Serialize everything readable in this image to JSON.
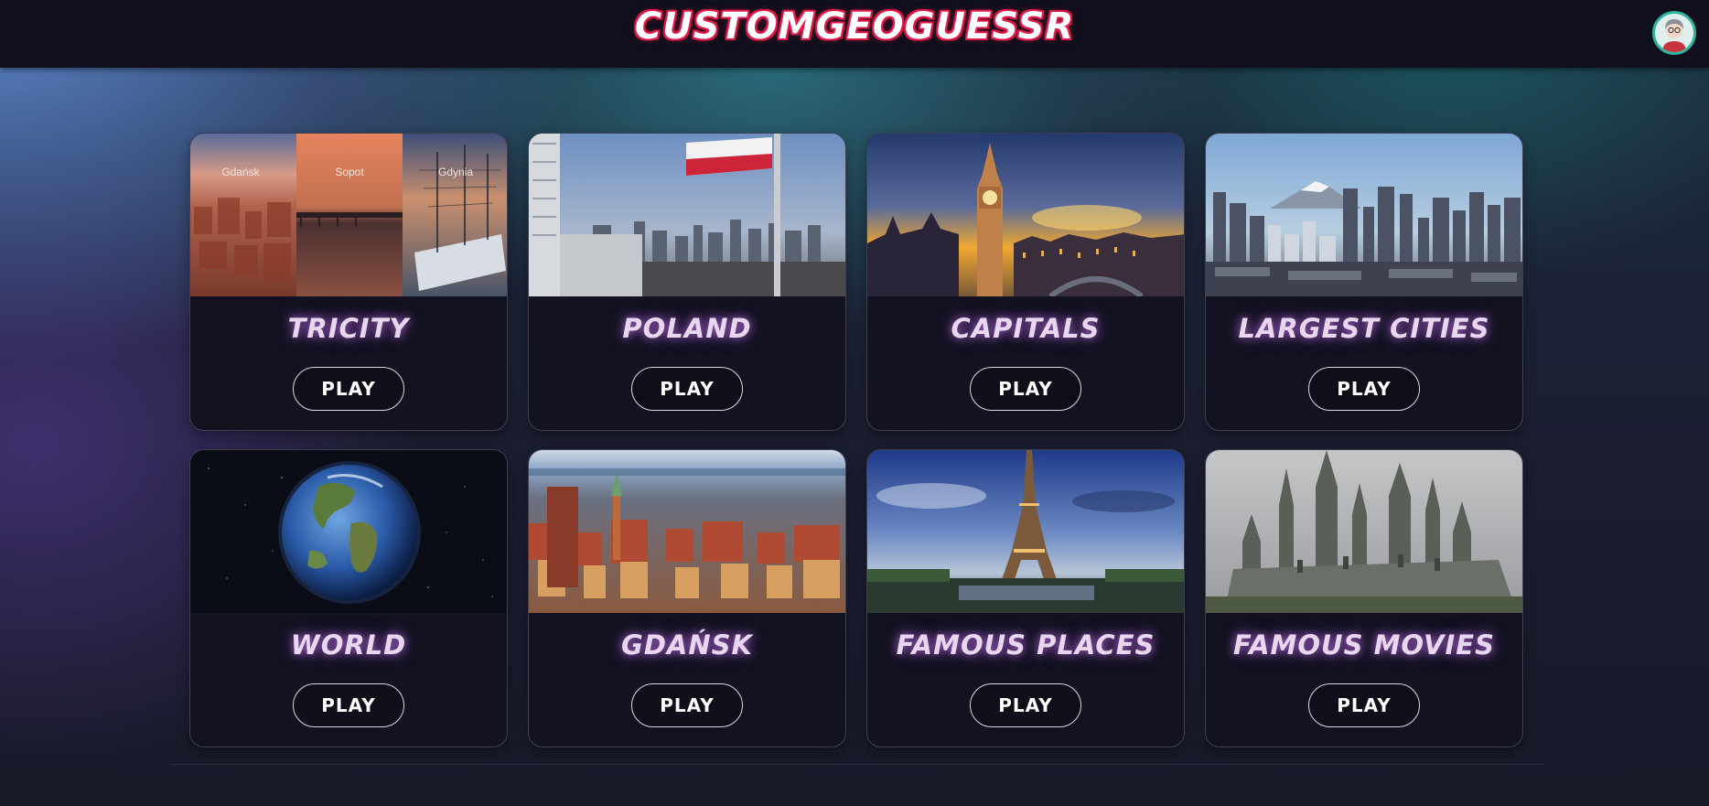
{
  "header": {
    "logo_text": "CUSTOMGEOGUESSR",
    "avatar_icon": "user-avatar-icon"
  },
  "colors": {
    "topbar": "#100f1c",
    "logo_outline": "#e01848",
    "card_bg": "#121220",
    "title_glow": "#be6ee6",
    "avatar_ring": "#2fb3a1"
  },
  "cards": [
    {
      "title": "TRICITY",
      "play_label": "PLAY",
      "image": "tricity-collage",
      "image_labels": [
        "Gdańsk",
        "Sopot",
        "Gdynia"
      ]
    },
    {
      "title": "POLAND",
      "play_label": "PLAY",
      "image": "warsaw-skyline-flag"
    },
    {
      "title": "CAPITALS",
      "play_label": "PLAY",
      "image": "big-ben-sunset"
    },
    {
      "title": "LARGEST CITIES",
      "play_label": "PLAY",
      "image": "tokyo-skyline-fuji"
    },
    {
      "title": "WORLD",
      "play_label": "PLAY",
      "image": "earth-from-space"
    },
    {
      "title": "GDAŃSK",
      "play_label": "PLAY",
      "image": "gdansk-old-town"
    },
    {
      "title": "FAMOUS PLACES",
      "play_label": "PLAY",
      "image": "eiffel-tower"
    },
    {
      "title": "FAMOUS MOVIES",
      "play_label": "PLAY",
      "image": "castle-spires"
    }
  ]
}
